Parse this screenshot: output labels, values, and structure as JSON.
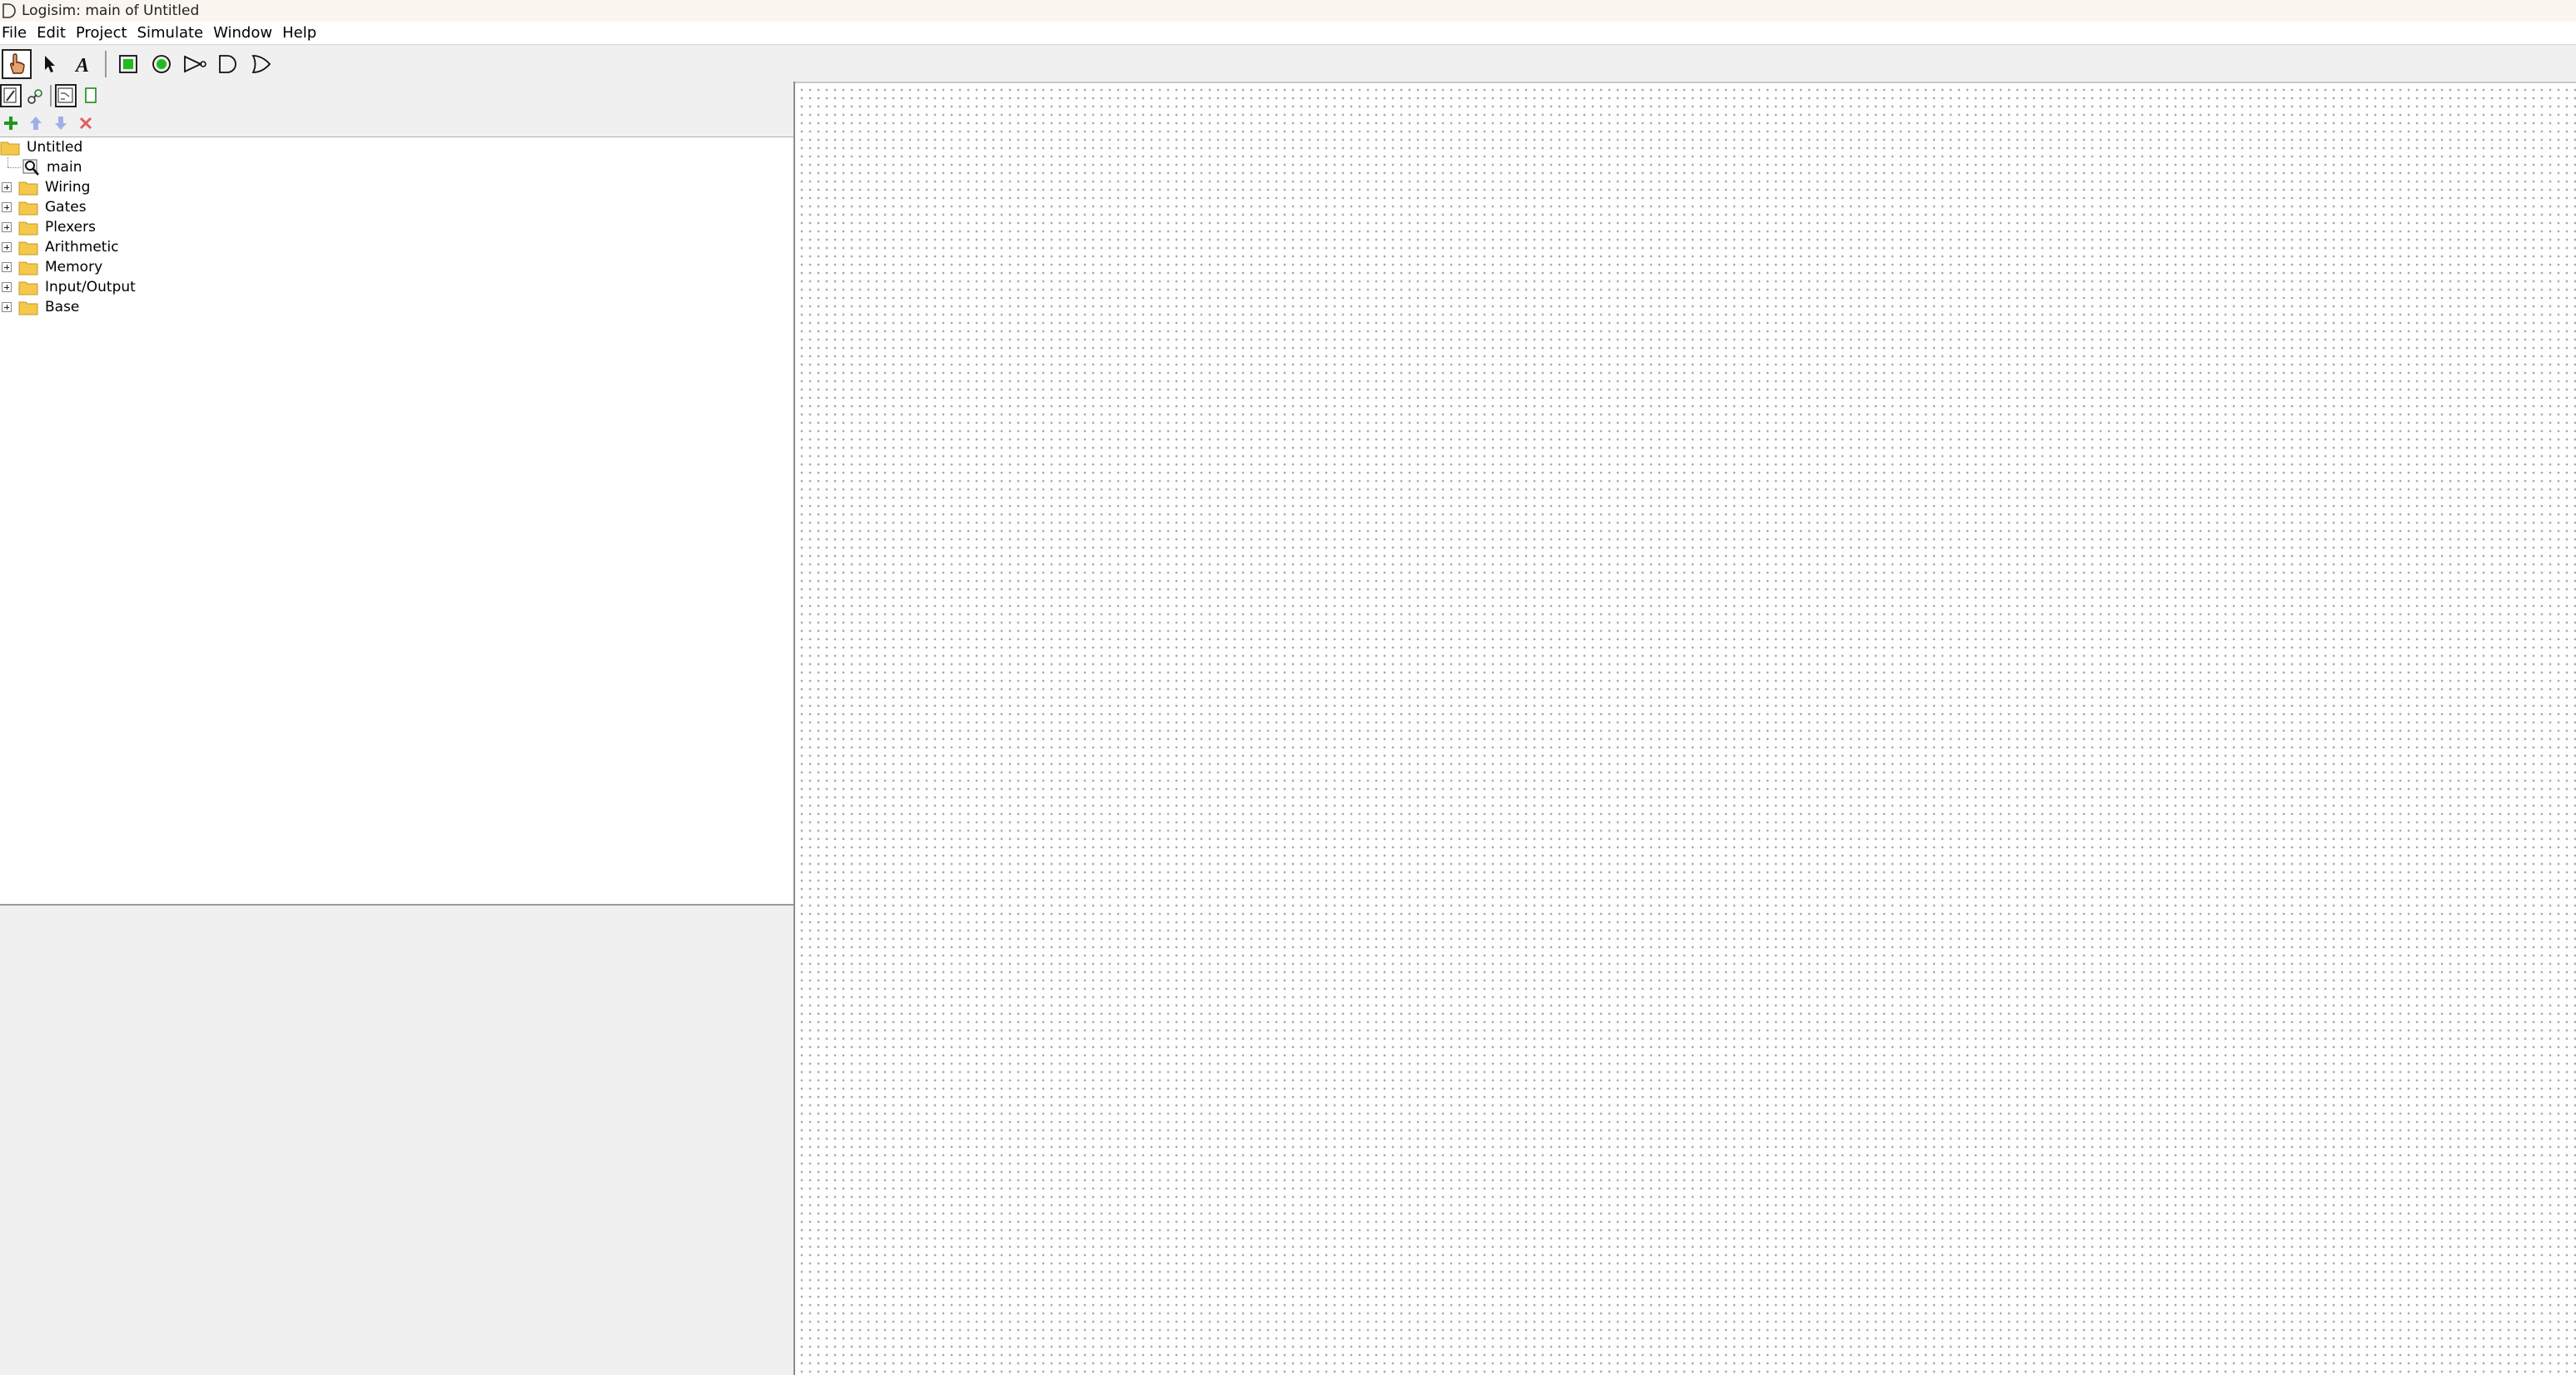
{
  "window": {
    "title": "Logisim: main of Untitled"
  },
  "menubar": {
    "items": [
      "File",
      "Edit",
      "Project",
      "Simulate",
      "Window",
      "Help"
    ]
  },
  "toolbar": {
    "tools": [
      {
        "icon": "hand-poke-icon",
        "selected": true
      },
      {
        "icon": "arrow-select-icon",
        "selected": false
      },
      {
        "icon": "text-tool-icon",
        "selected": false
      },
      {
        "icon": "input-pin-icon",
        "selected": false
      },
      {
        "icon": "output-pin-icon",
        "selected": false
      },
      {
        "icon": "not-gate-icon",
        "selected": false
      },
      {
        "icon": "and-gate-icon",
        "selected": false
      },
      {
        "icon": "or-gate-icon",
        "selected": false
      }
    ]
  },
  "explorer": {
    "tree": [
      {
        "label": "Untitled",
        "type": "project"
      },
      {
        "label": "main",
        "type": "circuit"
      },
      {
        "label": "Wiring",
        "type": "library"
      },
      {
        "label": "Gates",
        "type": "library"
      },
      {
        "label": "Plexers",
        "type": "library"
      },
      {
        "label": "Arithmetic",
        "type": "library"
      },
      {
        "label": "Memory",
        "type": "library"
      },
      {
        "label": "Input/Output",
        "type": "library"
      },
      {
        "label": "Base",
        "type": "library"
      }
    ]
  },
  "colors": {
    "folder": "#f4c84a",
    "add_green": "#1a9a1a",
    "pin_green": "#22bb22",
    "remove_red": "#e06060",
    "move_blue": "#8aa0e6"
  }
}
